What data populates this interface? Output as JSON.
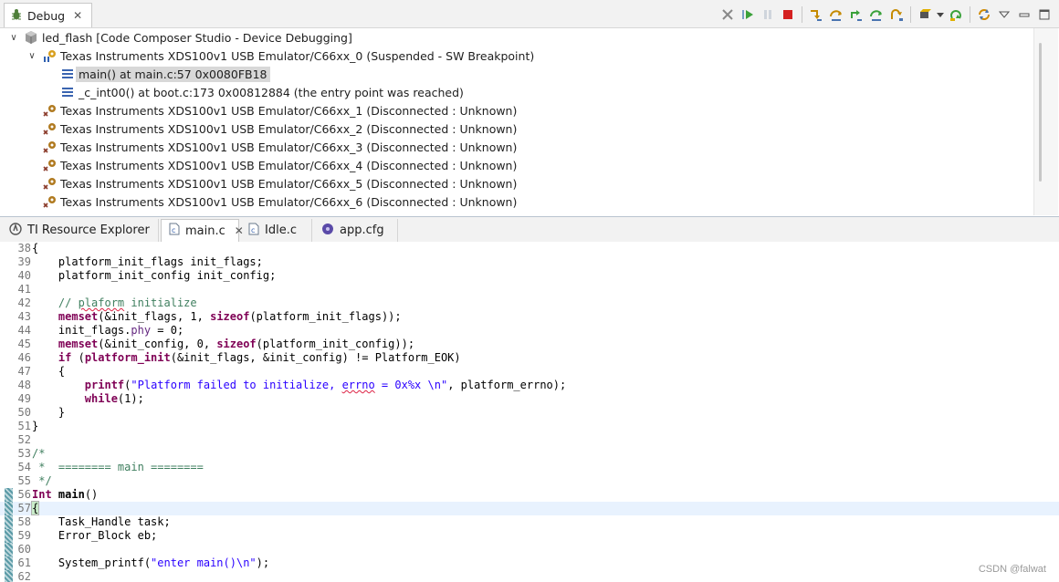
{
  "debug_view": {
    "tab_label": "Debug",
    "tree": [
      {
        "label": "led_flash [Code Composer Studio - Device Debugging]",
        "icon": "debug-session-icon",
        "twisty": "v"
      },
      {
        "label": "Texas Instruments XDS100v1 USB Emulator/C66xx_0 (Suspended - SW Breakpoint)",
        "icon": "cpu-suspended-icon",
        "twisty": "v"
      },
      {
        "label": "main() at main.c:57 0x0080FB18",
        "icon": "stack-frame-icon",
        "selected": true
      },
      {
        "label": "_c_int00() at boot.c:173 0x00812884  (the entry point was reached)",
        "icon": "stack-frame-icon"
      },
      {
        "label": "Texas Instruments XDS100v1 USB Emulator/C66xx_1 (Disconnected : Unknown)",
        "icon": "cpu-disconnected-icon"
      },
      {
        "label": "Texas Instruments XDS100v1 USB Emulator/C66xx_2 (Disconnected : Unknown)",
        "icon": "cpu-disconnected-icon"
      },
      {
        "label": "Texas Instruments XDS100v1 USB Emulator/C66xx_3 (Disconnected : Unknown)",
        "icon": "cpu-disconnected-icon"
      },
      {
        "label": "Texas Instruments XDS100v1 USB Emulator/C66xx_4 (Disconnected : Unknown)",
        "icon": "cpu-disconnected-icon"
      },
      {
        "label": "Texas Instruments XDS100v1 USB Emulator/C66xx_5 (Disconnected : Unknown)",
        "icon": "cpu-disconnected-icon"
      },
      {
        "label": "Texas Instruments XDS100v1 USB Emulator/C66xx_6 (Disconnected : Unknown)",
        "icon": "cpu-disconnected-icon"
      }
    ],
    "toolbar": [
      "remove-terminated-icon",
      "resume-icon",
      "suspend-icon",
      "terminate-icon",
      "step-into-icon",
      "step-over-icon",
      "step-return-icon",
      "assembly-step-over-icon",
      "run-to-line-icon",
      "reset-cpu-icon",
      "view-menu-dropdown-icon",
      "restart-icon",
      "refresh-icon",
      "view-menu-icon",
      "minimize-icon",
      "maximize-icon"
    ]
  },
  "editor_tabs": [
    {
      "label": "TI Resource Explorer",
      "icon": "ti-resource-explorer-icon",
      "active": false
    },
    {
      "label": "main.c",
      "icon": "c-file-icon",
      "active": true
    },
    {
      "label": "Idle.c",
      "icon": "c-file-icon",
      "active": false
    },
    {
      "label": "app.cfg",
      "icon": "cfg-file-icon",
      "active": false
    }
  ],
  "code_lines": [
    {
      "n": "38",
      "text": "{"
    },
    {
      "n": "39",
      "text": "    platform_init_flags init_flags;"
    },
    {
      "n": "40",
      "text": "    platform_init_config init_config;"
    },
    {
      "n": "41",
      "text": ""
    },
    {
      "n": "42",
      "text": "    // plaform initialize"
    },
    {
      "n": "43",
      "text": "    memset(&init_flags, 1, sizeof(platform_init_flags));"
    },
    {
      "n": "44",
      "text": "    init_flags.phy = 0;"
    },
    {
      "n": "45",
      "text": "    memset(&init_config, 0, sizeof(platform_init_config));"
    },
    {
      "n": "46",
      "text": "    if (platform_init(&init_flags, &init_config) != Platform_EOK)"
    },
    {
      "n": "47",
      "text": "    {"
    },
    {
      "n": "48",
      "text": "        printf(\"Platform failed to initialize, errno = 0x%x \\n\", platform_errno);"
    },
    {
      "n": "49",
      "text": "        while(1);"
    },
    {
      "n": "50",
      "text": "    }"
    },
    {
      "n": "51",
      "text": "}"
    },
    {
      "n": "52",
      "text": ""
    },
    {
      "n": "53",
      "text": "/*"
    },
    {
      "n": "54",
      "text": " *  ======== main ========"
    },
    {
      "n": "55",
      "text": " */"
    },
    {
      "n": "56",
      "text": "Int main()"
    },
    {
      "n": "57",
      "text": "{"
    },
    {
      "n": "58",
      "text": "    Task_Handle task;"
    },
    {
      "n": "59",
      "text": "    Error_Block eb;"
    },
    {
      "n": "60",
      "text": ""
    },
    {
      "n": "61",
      "text": "    System_printf(\"enter main()\\n\");"
    },
    {
      "n": "62",
      "text": ""
    }
  ],
  "current_line": "57",
  "watermark": "CSDN @falwat"
}
